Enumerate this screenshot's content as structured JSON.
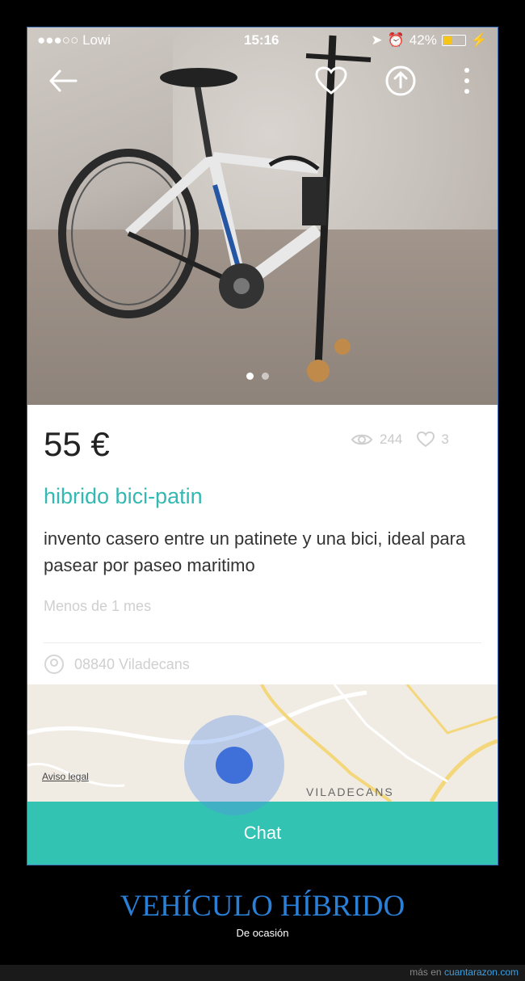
{
  "status_bar": {
    "carrier": "●●●○○ Lowi",
    "time": "15:16",
    "battery": "42%",
    "battery_level": 0.42
  },
  "product": {
    "price": "55 €",
    "views": "244",
    "likes": "3",
    "title": "hibrido bici-patin",
    "description": "invento casero entre un patinete y una bici, ideal para pasear por paseo maritimo",
    "date": "Menos de 1 mes",
    "location": "08840 Viladecans"
  },
  "map": {
    "legal": "Aviso legal",
    "label": "VILADECANS"
  },
  "chat_button": "Chat",
  "caption": {
    "title": "VEHÍCULO HÍBRIDO",
    "subtitle": "De ocasión"
  },
  "footer": {
    "prefix": "más en ",
    "site": "cuantarazon.com"
  },
  "colors": {
    "accent": "#34b8b3",
    "chat": "#33c3b3",
    "caption": "#2a7fd6"
  }
}
